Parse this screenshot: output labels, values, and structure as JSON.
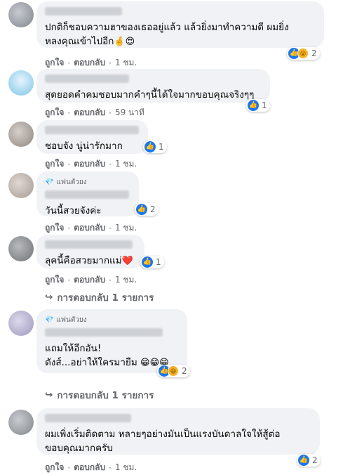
{
  "actions": {
    "like": "ถูกใจ",
    "reply": "ตอบกลับ",
    "dot": "·"
  },
  "fan_badge": "แฟนตัวยง",
  "comments": [
    {
      "text": "ปกติก็ชอบความฮาของเธออยู่แล้ว แล้วยิ่งมาทำความดี ผมยิ่ง\nหลงคุณเข้าไปอีก",
      "emojis": "🤞😍",
      "time": "1 ชม.",
      "reactions": "2",
      "reaction_icons": [
        "like-icon",
        "wow-icon"
      ]
    },
    {
      "text": "สุดยอดคำคมชอบมากคำๆนี้ได้ใจมากขอบคุณจริงๆๆ",
      "time": "59 นาที",
      "reactions": "1",
      "reaction_icons": [
        "like-icon"
      ]
    },
    {
      "text": "ชอบจัง นู่น่ารักมาก",
      "time": "1 ชม.",
      "reactions": "1",
      "reaction_icons": [
        "like-icon"
      ]
    },
    {
      "text": "วันนี้สวยจังค่ะ",
      "time": "1 ชม.",
      "reactions": "2",
      "reaction_icons": [
        "like-icon"
      ],
      "badge": true
    },
    {
      "text": "ลุคนี้คือสวยมากแม่",
      "emojis": "❤️",
      "time": "1 ชม.",
      "reactions": "1",
      "reaction_icons": [
        "like-icon"
      ]
    },
    {
      "text": "แถมให้อีกอัน!\nตังส์...อย่าให้ใครมายืม",
      "emojis": "😁😁😁",
      "time": "",
      "reactions": "2",
      "reaction_icons": [
        "like-icon",
        "haha-icon"
      ],
      "badge": true
    },
    {
      "text": "ผมเพิ่งเริ่มติดตาม หลายๆอย่างมันเป็นแรงบันดาลใจให้สู้ต่อ\nขอบคุณมากครับ",
      "time": "1 ชม.",
      "reactions": "2",
      "reaction_icons": [
        "like-icon"
      ]
    }
  ],
  "reply_links": [
    "การตอบกลับ 1 รายการ",
    "การตอบกลับ 1 รายการ"
  ],
  "avatar_colors": [
    "#9a9fa6",
    "#a9d7ee",
    "#b0a8a3",
    "#c2bab3",
    "#8d8f93",
    "#b7b3cf",
    "#9ea2a8"
  ]
}
